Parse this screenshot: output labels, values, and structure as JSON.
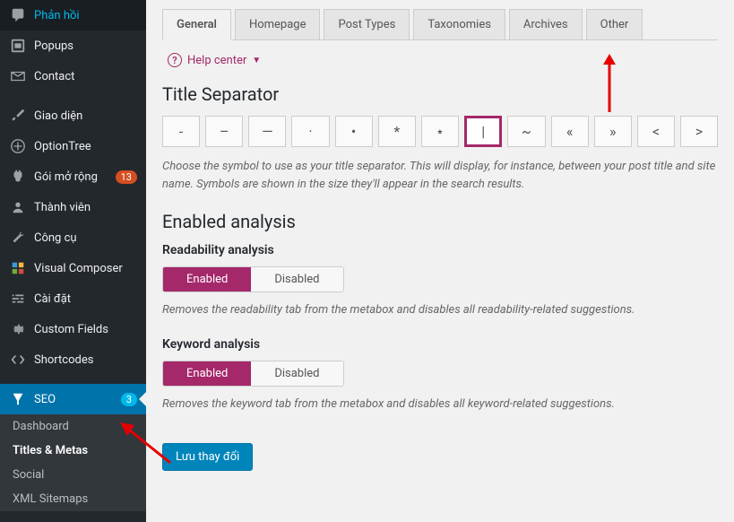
{
  "sidebar": {
    "items": [
      {
        "label": "Phản hồi"
      },
      {
        "label": "Popups"
      },
      {
        "label": "Contact"
      },
      {
        "label": "Giao diện"
      },
      {
        "label": "OptionTree"
      },
      {
        "label": "Gói mở rộng",
        "badge": "13"
      },
      {
        "label": "Thành viên"
      },
      {
        "label": "Công cụ"
      },
      {
        "label": "Visual Composer"
      },
      {
        "label": "Cài đặt"
      },
      {
        "label": "Custom Fields"
      },
      {
        "label": "Shortcodes"
      },
      {
        "label": "SEO",
        "badge": "3"
      }
    ],
    "submenu": [
      {
        "label": "Dashboard"
      },
      {
        "label": "Titles & Metas"
      },
      {
        "label": "Social"
      },
      {
        "label": "XML Sitemaps"
      }
    ]
  },
  "tabs": [
    "General",
    "Homepage",
    "Post Types",
    "Taxonomies",
    "Archives",
    "Other"
  ],
  "help_center": "Help center",
  "title_separator": {
    "heading": "Title Separator",
    "options": [
      "-",
      "–",
      "—",
      "·",
      "•",
      "*",
      "⋆",
      "|",
      "~",
      "«",
      "»",
      "<",
      ">"
    ],
    "desc": "Choose the symbol to use as your title separator. This will display, for instance, between your post title and site name. Symbols are shown in the size they'll appear in the search results."
  },
  "enabled_analysis": {
    "heading": "Enabled analysis",
    "readability": {
      "label": "Readability analysis",
      "enabled": "Enabled",
      "disabled": "Disabled",
      "desc": "Removes the readability tab from the metabox and disables all readability-related suggestions."
    },
    "keyword": {
      "label": "Keyword analysis",
      "enabled": "Enabled",
      "disabled": "Disabled",
      "desc": "Removes the keyword tab from the metabox and disables all keyword-related suggestions."
    }
  },
  "save_button": "Lưu thay đổi"
}
